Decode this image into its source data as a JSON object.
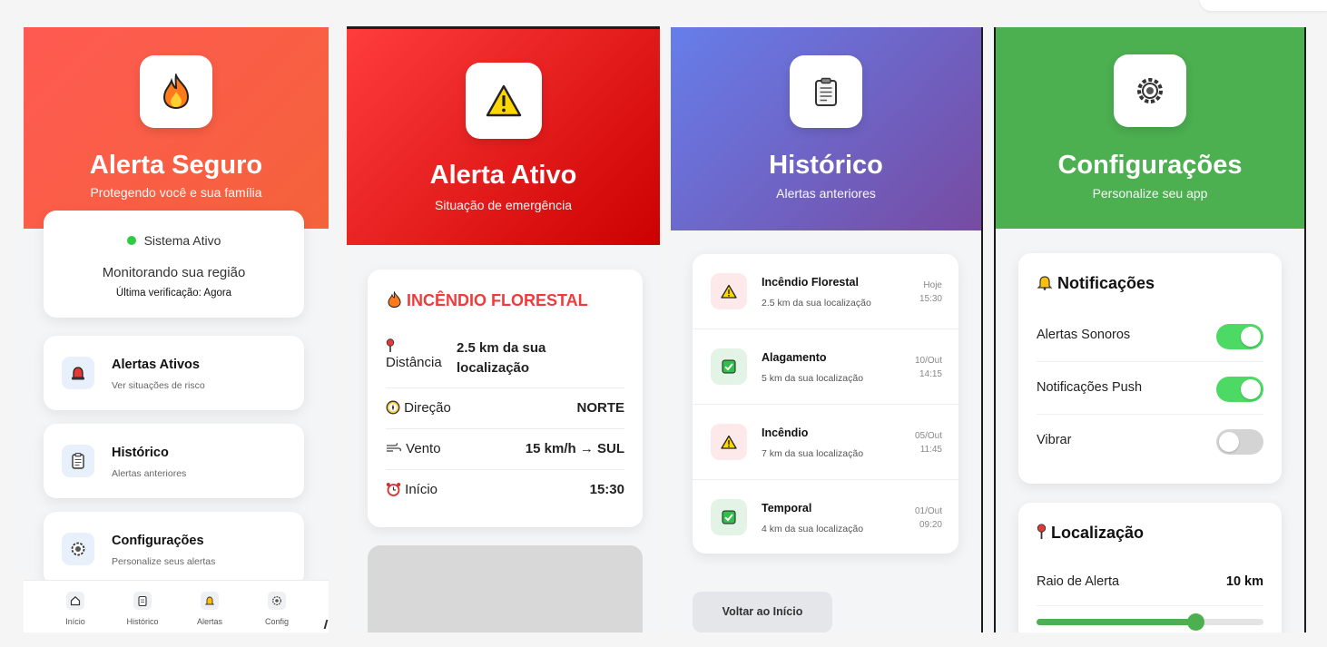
{
  "screen_home": {
    "title": "Alerta Seguro",
    "subtitle": "Protegendo você e sua família",
    "logo_icon": "fire-icon",
    "status": {
      "label": "Sistema Ativo",
      "monitoring": "Monitorando sua região",
      "last_check": "Última verificação: Agora",
      "dot_color": "#2ecc40"
    },
    "menu": [
      {
        "title": "Alertas Ativos",
        "subtitle": "Ver situações de risco",
        "icon": "siren-icon"
      },
      {
        "title": "Histórico",
        "subtitle": "Alertas anteriores",
        "icon": "clipboard-icon"
      },
      {
        "title": "Configurações",
        "subtitle": "Personalize seus alertas",
        "icon": "gear-icon"
      }
    ],
    "nav": [
      {
        "label": "Início",
        "icon": "home-icon"
      },
      {
        "label": "Histórico",
        "icon": "clipboard-icon"
      },
      {
        "label": "Alertas",
        "icon": "bell-icon"
      },
      {
        "label": "Config",
        "icon": "gear-icon"
      }
    ],
    "colors": {
      "gradient_start": "#ff5a52",
      "gradient_end": "#f4623a"
    }
  },
  "screen_alert": {
    "title": "Alerta Ativo",
    "subtitle": "Situação de emergência",
    "logo_icon": "warning-icon",
    "card_title": "INCÊNDIO FLORESTAL",
    "details": [
      {
        "label": "Distância",
        "value": "2.5 km da sua localização",
        "icon": "pin-icon"
      },
      {
        "label": "Direção",
        "value": "NORTE",
        "icon": "compass-icon"
      },
      {
        "label": "Vento",
        "value": "15 km/h → SUL",
        "icon": "wind-icon"
      },
      {
        "label": "Início",
        "value": "15:30",
        "icon": "alarm-clock-icon"
      }
    ],
    "colors": {
      "gradient_start": "#ff3d3d",
      "gradient_end": "#cc0000",
      "title": "#ef3b3b"
    }
  },
  "screen_history": {
    "title": "Histórico",
    "subtitle": "Alertas anteriores",
    "logo_icon": "clipboard-icon",
    "items": [
      {
        "title": "Incêndio Florestal",
        "subtitle": "2.5 km da sua localização",
        "date": "Hoje",
        "time": "15:30",
        "icon": "warning-icon"
      },
      {
        "title": "Alagamento",
        "subtitle": "5 km da sua localização",
        "date": "10/Out",
        "time": "14:15",
        "icon": "check-icon"
      },
      {
        "title": "Incêndio",
        "subtitle": "7 km da sua localização",
        "date": "05/Out",
        "time": "11:45",
        "icon": "warning-icon"
      },
      {
        "title": "Temporal",
        "subtitle": "4 km da sua localização",
        "date": "01/Out",
        "time": "09:20",
        "icon": "check-icon"
      }
    ],
    "back_label": "Voltar ao Início",
    "colors": {
      "gradient_start": "#667eea",
      "gradient_end": "#764ba2"
    }
  },
  "screen_settings": {
    "title": "Configurações",
    "subtitle": "Personalize seu app",
    "logo_icon": "gear-icon",
    "notifications": {
      "heading": "Notificações",
      "toggles": [
        {
          "label": "Alertas Sonoros",
          "on": true
        },
        {
          "label": "Notificações Push",
          "on": true
        },
        {
          "label": "Vibrar",
          "on": false
        }
      ]
    },
    "location": {
      "heading": "Localização",
      "radius_label": "Raio de Alerta",
      "radius_value": "10 km",
      "slider_fraction": 0.7
    },
    "colors": {
      "header": "#4caf50",
      "toggle_on": "#4cd964"
    }
  }
}
